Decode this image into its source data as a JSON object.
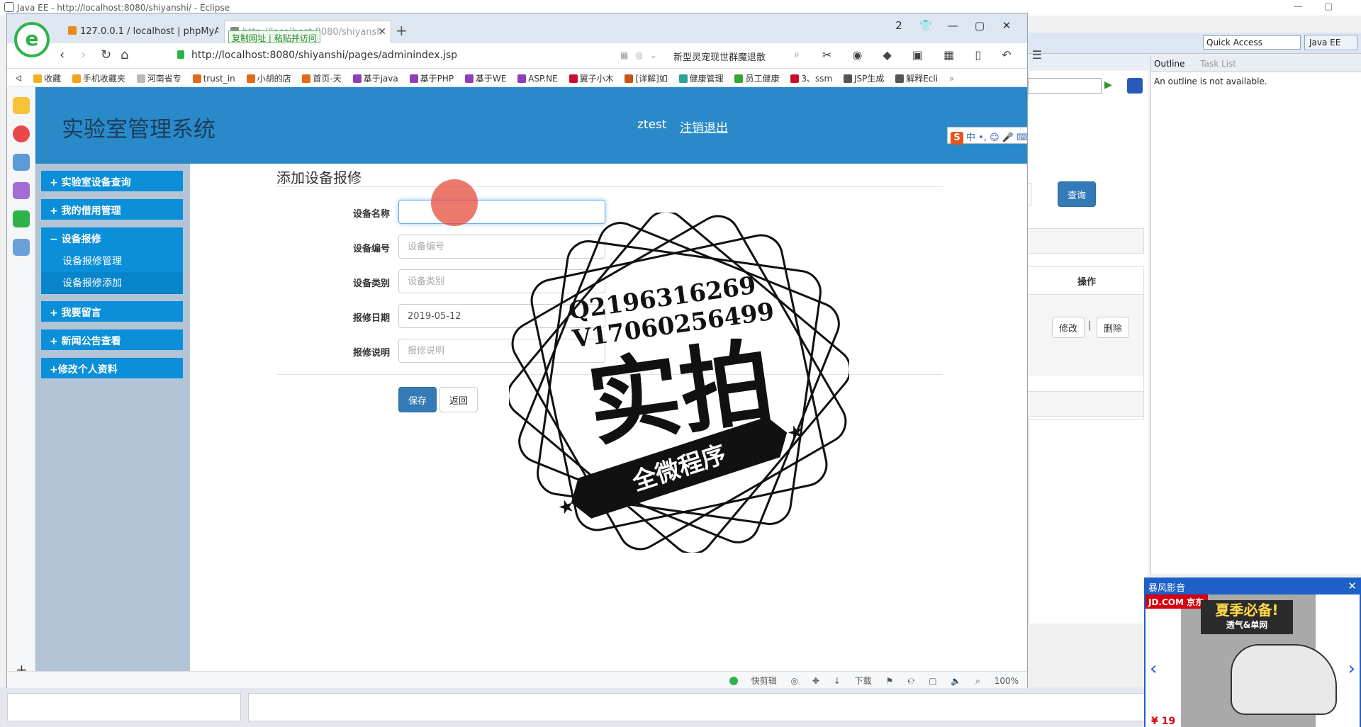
{
  "eclipse": {
    "title": "Java EE - http://localhost:8080/shiyanshi/ - Eclipse",
    "quick_access": "Quick Access",
    "perspective": "Java EE",
    "outline_tab": "Outline",
    "tasklist_tab": "Task List",
    "outline_message": "An outline is not available."
  },
  "browser": {
    "tabs": [
      {
        "label": "127.0.0.1 / localhost | phpMyA"
      },
      {
        "label": "http://localhost:8080/shiyansh"
      }
    ],
    "tab_popup": [
      "复制网址",
      "粘贴并访问"
    ],
    "badge": "2",
    "url": "http://localhost:8080/shiyanshi/pages/adminindex.jsp",
    "news": "新型灵宠现世群魔退散",
    "bookmarks": [
      {
        "label": "收藏",
        "color": "#f2b01e"
      },
      {
        "label": "手机收藏夹",
        "color": "#f2a21e"
      },
      {
        "label": "河南省专",
        "color": "#999999"
      },
      {
        "label": "trust_in",
        "color": "#e06a1a"
      },
      {
        "label": "小胡的店",
        "color": "#e06a1a"
      },
      {
        "label": "首页-天",
        "color": "#e06a1a"
      },
      {
        "label": "基于java",
        "color": "#8b3fb8"
      },
      {
        "label": "基于PHP",
        "color": "#8b3fb8"
      },
      {
        "label": "基于WE",
        "color": "#8b3fb8"
      },
      {
        "label": "ASP.NE",
        "color": "#8b3fb8"
      },
      {
        "label": "翼子小木",
        "color": "#c8102e"
      },
      {
        "label": "[详解]如",
        "color": "#c4571b"
      },
      {
        "label": "健康管理",
        "color": "#2ba39a"
      },
      {
        "label": "员工健康",
        "color": "#34a534"
      },
      {
        "label": "3、ssm",
        "color": "#c8102e"
      },
      {
        "label": "JSP生成",
        "color": "#555555"
      },
      {
        "label": "解释Ecli",
        "color": "#555555"
      }
    ],
    "status": [
      "快剪辑",
      "下载",
      "100%"
    ]
  },
  "page": {
    "system_title": "实验室管理系统",
    "username": "ztest",
    "logout": "注销退出",
    "ime": "中 •, ☺ 🎤 ⌨ 👔 ▦"
  },
  "sidebar": {
    "items": [
      {
        "label": "+ 实验室设备查询"
      },
      {
        "label": "+ 我的借用管理"
      },
      {
        "label": "− 设备报修",
        "subs": [
          "设备报修管理",
          "设备报修添加"
        ]
      },
      {
        "label": "+ 我要留言"
      },
      {
        "label": "+ 新闻公告查看"
      },
      {
        "label": "+修改个人资料"
      }
    ]
  },
  "form": {
    "title": "添加设备报修",
    "fields": [
      {
        "label": "设备名称",
        "value": "",
        "placeholder": ""
      },
      {
        "label": "设备编号",
        "value": "",
        "placeholder": "设备编号"
      },
      {
        "label": "设备类别",
        "value": "",
        "placeholder": "设备类别"
      },
      {
        "label": "报修日期",
        "value": "2019-05-12",
        "placeholder": ""
      },
      {
        "label": "报修说明",
        "value": "",
        "placeholder": "报修说明"
      }
    ],
    "save": "保存",
    "back": "返回"
  },
  "underpage": {
    "query": "查询",
    "col_header": "操作",
    "edit": "修改",
    "sep": "|",
    "delete": "删除"
  },
  "watermark": {
    "line1": "Q2196316269",
    "line2": "V17060256499",
    "big": "实拍",
    "banner": "全微程序"
  },
  "ad": {
    "title": "暴风影音",
    "brand": "JD.COM 京东",
    "slogan": "夏季必备!",
    "slogan_sub": "透气&单网",
    "price": "¥ 19"
  }
}
